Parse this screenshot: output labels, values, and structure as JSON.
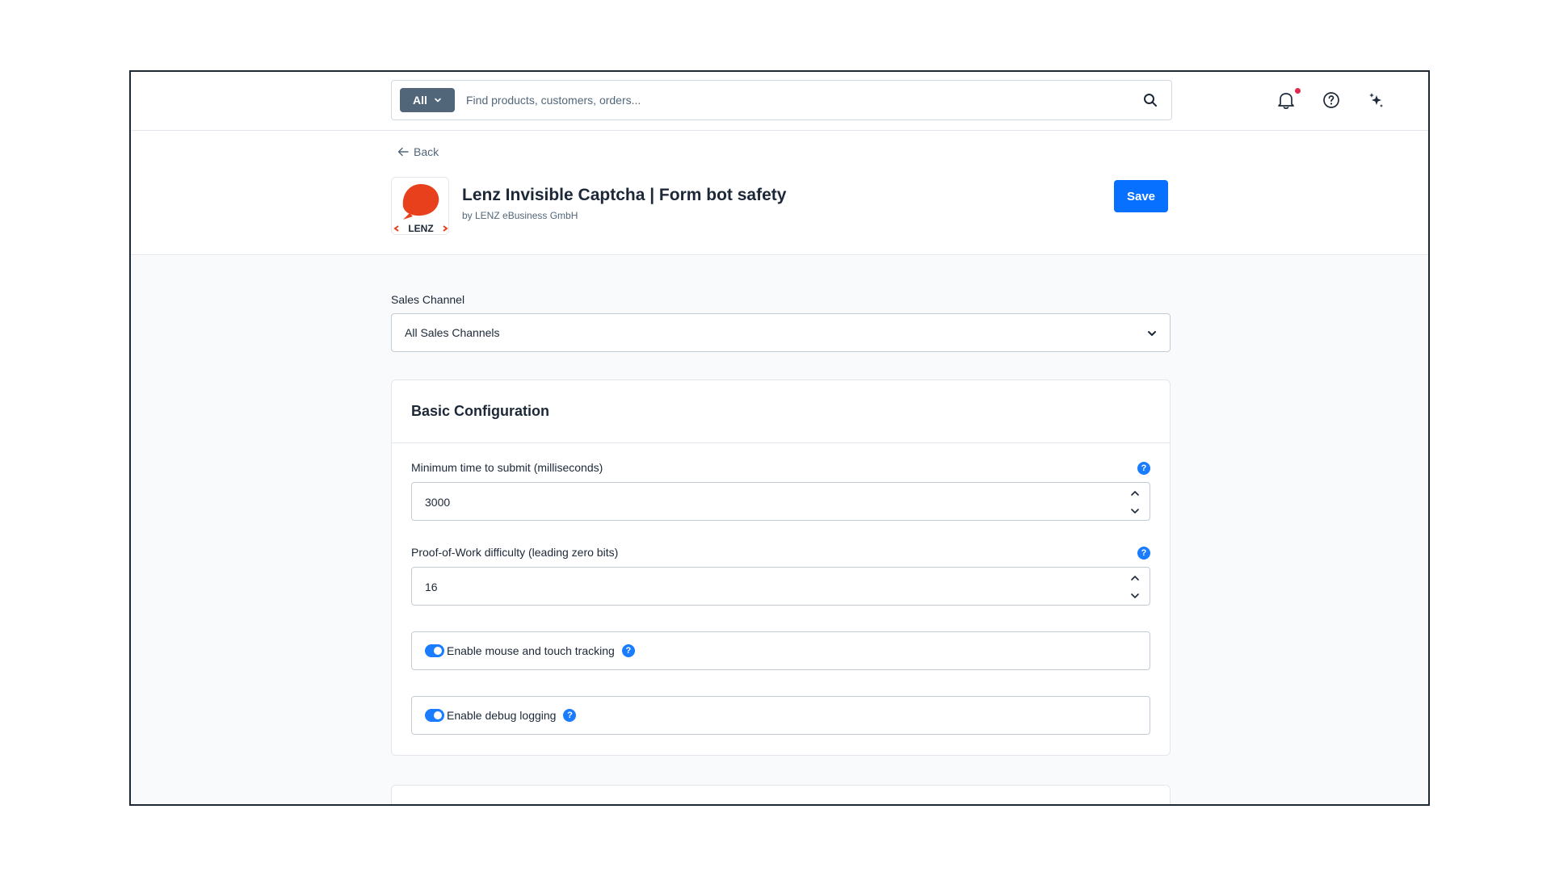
{
  "topbar": {
    "search_scope": "All",
    "search_placeholder": "Find products, customers, orders...",
    "icons": [
      "search-icon",
      "bell-icon",
      "help-icon",
      "sparkle-icon"
    ]
  },
  "header": {
    "back_label": "Back",
    "app_title": "Lenz Invisible Captcha | Form bot safety",
    "app_author": "by LENZ eBusiness GmbH",
    "logo_text": "LENZ",
    "save_label": "Save"
  },
  "sales_channel": {
    "label": "Sales Channel",
    "selected": "All Sales Channels"
  },
  "basic_config": {
    "title": "Basic Configuration",
    "min_time": {
      "label": "Minimum time to submit (milliseconds)",
      "value": "3000"
    },
    "pow_difficulty": {
      "label": "Proof-of-Work difficulty (leading zero bits)",
      "value": "16"
    },
    "mouse_tracking": {
      "label": "Enable mouse and touch tracking",
      "enabled": true
    },
    "debug_logging": {
      "label": "Enable debug logging",
      "enabled": true
    },
    "help_glyph": "?"
  },
  "colors": {
    "primary": "#0870ff",
    "scope_bg": "#52667a",
    "toggle_on": "#1a7cff",
    "logo_red": "#e8401c",
    "notification": "#de294c"
  }
}
